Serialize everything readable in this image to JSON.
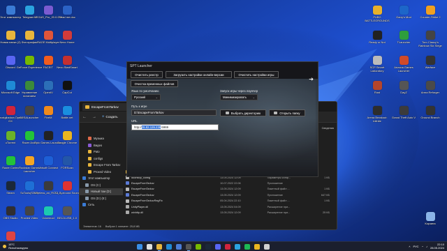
{
  "desktop": {
    "left_icons": [
      {
        "label": "Этот компьютер",
        "color": "#3a7bd5"
      },
      {
        "label": "Telegram A",
        "color": "#2aa3e0"
      },
      {
        "label": "VEGAS_Pro_20.0.0.411_portable",
        "color": "#7a5bd1"
      },
      {
        "label": "Read me.doc",
        "color": "#2b62c6"
      },
      {
        "label": "Новая папка (2)",
        "color": "#e8b53c"
      },
      {
        "label": "Фотографии",
        "color": "#e8b53c"
      },
      {
        "label": "RAGE Multiplayer",
        "color": "#e0553a"
      },
      {
        "label": "Nexo Home",
        "color": "#d23b3b"
      },
      {
        "label": "Discord",
        "color": "#5865f2"
      },
      {
        "label": "GeForce Experience",
        "color": "#76b900"
      },
      {
        "label": "FACEIT",
        "color": "#f25c1e"
      },
      {
        "label": "Nexo StartSmart",
        "color": "#c43030"
      },
      {
        "label": "Microsoft Edge",
        "color": "#1f8ad6"
      },
      {
        "label": "Управление питанием",
        "color": "#3b8a3b"
      },
      {
        "label": "OpenIV",
        "color": "#2c6fb8"
      },
      {
        "label": "CapCut",
        "color": "#111111"
      },
      {
        "label": "Proxigliadora Opera GX",
        "color": "#d0243c"
      },
      {
        "label": "D2SALauncher",
        "color": "#444444"
      },
      {
        "label": "FiveM",
        "color": "#f08a1c"
      },
      {
        "label": "Battle.net",
        "color": "#1a8ee0"
      },
      {
        "label": "uTorrent",
        "color": "#6bb12a"
      },
      {
        "label": "Razer Axon",
        "color": "#23c23a"
      },
      {
        "label": "Epic Games Launcher",
        "color": "#222222"
      },
      {
        "label": "Google Chrome",
        "color": "#e9b520"
      },
      {
        "label": "Razer Cortex",
        "color": "#23c23a"
      },
      {
        "label": "Rockstar Games Launcher",
        "color": "#f4a523"
      },
      {
        "label": "Ubisoft Connect",
        "color": "#1d5fd6"
      },
      {
        "label": "FORScan",
        "color": "#2356a8"
      },
      {
        "label": "Steam",
        "color": "#1b2838"
      },
      {
        "label": "ScTools(S3v3)",
        "color": "#1e6fd6"
      },
      {
        "label": "Wireless_an_ROG_2_PC",
        "color": "#3b3b3b"
      },
      {
        "label": "7-1 Surround Sound",
        "color": "#d33"
      },
      {
        "label": "OBS Studio",
        "color": "#302e31"
      },
      {
        "label": "Proxied Video",
        "color": "#444444"
      },
      {
        "label": "Voicemod",
        "color": "#1cc9b0"
      },
      {
        "label": "BE12LUSB_1.0",
        "color": "#555555"
      },
      {
        "label": "Hitmanpro",
        "color": "#d44"
      }
    ],
    "right_icons": [
      {
        "label": "PUBG BATTLEGROUNDS",
        "color": "#e8b12a"
      },
      {
        "label": "Garry's Mod",
        "color": "#1d66c9"
      },
      {
        "label": "Counter-Strike 2",
        "color": "#f0a020"
      },
      {
        "label": "Ready or Not",
        "color": "#222222"
      },
      {
        "label": "TLauncher",
        "color": "#2e9e3d"
      },
      {
        "label": "Tom Clancy's Rainbow Six Siege",
        "color": "#444444"
      },
      {
        "label": "SCP Secret Laboratory",
        "color": "#bbbbbb"
      },
      {
        "label": "Arizona Games Launcher",
        "color": "#d04a2a"
      },
      {
        "label": "Warface",
        "color": "#333333"
      },
      {
        "label": "Rust",
        "color": "#b5452c"
      },
      {
        "label": "DayZ",
        "color": "#555555"
      },
      {
        "label": "Arma Reforger",
        "color": "#4a4a4a"
      },
      {
        "label": "Arena Breakout: Infinite",
        "color": "#2d2d2d"
      },
      {
        "label": "Grand Theft Auto V",
        "color": "#3b3b3b"
      },
      {
        "label": "Ground Branch",
        "color": "#333333"
      },
      {
        "label": "Корзина",
        "color": "#8ab4e8"
      }
    ]
  },
  "explorer": {
    "tab_title": "EscapeFromTarkov",
    "tab_close": "×",
    "nav": {
      "back": "←",
      "forward": "→"
    },
    "new_button": {
      "plus": "+",
      "label": "Создать"
    },
    "right_action": "Сведения",
    "sidebar": [
      {
        "label": "Музыка",
        "color": "#e06a4a"
      },
      {
        "label": "Видео",
        "color": "#8a5bd6"
      },
      {
        "label": "Pato",
        "color": "#e8b53c"
      },
      {
        "label": "configs",
        "color": "#e8b53c"
      },
      {
        "label": "Escape From Tarkov",
        "color": "#e8b53c"
      },
      {
        "label": "Proxed Video",
        "color": "#e8b53c"
      },
      {
        "label": "Этот компьютер",
        "color": "#3a7bd5"
      },
      {
        "label": "OS (C:)",
        "color": "#8899aa"
      },
      {
        "label": "Новый том (D:)",
        "color": "#8899aa"
      },
      {
        "label": "OS (D:) (E:)",
        "color": "#8899aa"
      },
      {
        "label": "Сеть",
        "color": "#3a7bd5"
      }
    ],
    "files": [
      {
        "name": "BattlEye",
        "date": "13.05.2024 12:09",
        "type": "Папка с файлами",
        "size": "",
        "color": "#e8b53c"
      },
      {
        "name": "doorstop_config",
        "date": "13.05.2024 12:09",
        "type": "Параметры конф...",
        "size": "1 КБ",
        "color": "#bbbbbb"
      },
      {
        "name": "EscapeFromTarkov",
        "date": "10.07.2022 22:06",
        "type": "Приложение",
        "size": "",
        "color": "#5a7ad6"
      },
      {
        "name": "EscapeFromTarkov",
        "date": "13.05.2024 12:09",
        "type": "Пакетный файл ...",
        "size": "1 КБ",
        "color": "#bbbbbb"
      },
      {
        "name": "EscapeFromTarkov",
        "date": "13.05.2024 12:09",
        "type": "Приложение",
        "size": "647 КБ",
        "color": "#5a7ad6"
      },
      {
        "name": "EscapeFromTarkovRegFix",
        "date": "05.04.2024 22:10",
        "type": "Пакетный файл ...",
        "size": "1 КБ",
        "color": "#bbbbbb"
      },
      {
        "name": "UnityPlayer.dll",
        "date": "13.05.2024 04:09",
        "type": "Расширение при...",
        "size": "",
        "color": "#aaaaaa"
      },
      {
        "name": "winhttp.dll",
        "date": "13.05.2024 12:09",
        "type": "Расширение при...",
        "size": "25 КБ",
        "color": "#aaaaaa"
      }
    ],
    "status": {
      "count": "Элементов: 16",
      "selected": "Выбран 1 элемент: 25,8 МБ"
    }
  },
  "spt": {
    "title": "SPT Launcher",
    "buttons": {
      "clear_registry": "Очистить реестр",
      "load_online": "Загрузить настройки онлайн-версии",
      "clear_game_settings": "Очистить настройки игры",
      "clear_temp": "Очистка временных файлов"
    },
    "language_label": "Язык по умолчанию",
    "language_value": "Русский",
    "startup_label": "Запуск игры через лаунчер",
    "startup_value": "Минимизировать",
    "path_label": "Путь к игре",
    "path_value": "D:\\EscapeFromTarkov",
    "select_dir": "Выбрать директорию",
    "open_folder": "Открыть папку",
    "url_label": "URL",
    "url_prefix": "http://",
    "url_highlight": "26.82.126.238",
    "url_suffix": ":6969",
    "forward_arrow": "➔"
  },
  "taskbar": {
    "weather_temp": "15°C",
    "weather_desc": "Ясно/пасмурно",
    "apps": [
      {
        "name": "start",
        "color": "#3a8ee6"
      },
      {
        "name": "search",
        "color": "#e0e0e0"
      },
      {
        "name": "file-explorer",
        "color": "#e8b53c"
      },
      {
        "name": "edge",
        "color": "#1f8ad6"
      },
      {
        "name": "store",
        "color": "#4b7cd6"
      },
      {
        "name": "tarkov",
        "color": "#555555"
      },
      {
        "name": "nvidia",
        "color": "#76b900"
      },
      {
        "name": "steam",
        "color": "#1b2838"
      },
      {
        "name": "discord",
        "color": "#5865f2"
      },
      {
        "name": "opera-gx",
        "color": "#d0243c"
      },
      {
        "name": "telegram",
        "color": "#2aa3e0"
      },
      {
        "name": "spotify",
        "color": "#1db954"
      },
      {
        "name": "chrome",
        "color": "#e9b520"
      },
      {
        "name": "media",
        "color": "#d0d0d0"
      }
    ],
    "tray": {
      "lang": "РУС",
      "time": "22:10",
      "date": "28.05.2024"
    }
  }
}
